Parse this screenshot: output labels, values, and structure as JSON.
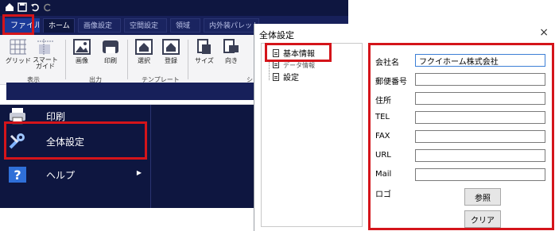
{
  "ribbon": {
    "tabs": [
      {
        "label": "ファイル"
      },
      {
        "label": "ホーム"
      },
      {
        "label": "画像設定"
      },
      {
        "label": "空間設定"
      },
      {
        "label": "領域"
      },
      {
        "label": "内外装パレット"
      }
    ],
    "buttons": [
      {
        "label": "グリッド",
        "icon": "grid-icon"
      },
      {
        "label": "スマート\nガイド",
        "icon": "smart-guide-icon"
      },
      {
        "label": "画像",
        "icon": "image-icon"
      },
      {
        "label": "印刷",
        "icon": "print-icon"
      },
      {
        "label": "選択",
        "icon": "house-select-icon"
      },
      {
        "label": "登録",
        "icon": "house-register-icon"
      },
      {
        "label": "サイズ",
        "icon": "size-icon"
      },
      {
        "label": "向き",
        "icon": "orientation-icon"
      }
    ],
    "groups": [
      {
        "label": "表示"
      },
      {
        "label": "出力"
      },
      {
        "label": "テンプレート"
      },
      {
        "label": "シ"
      }
    ]
  },
  "file_menu": {
    "items": [
      {
        "label": "印刷",
        "icon": "printer-icon"
      },
      {
        "label": "全体設定",
        "icon": "tools-settings-icon"
      },
      {
        "label": "ヘルプ",
        "icon": "help-icon",
        "has_submenu": true
      }
    ]
  },
  "dialog": {
    "title": "全体設定",
    "close_glyph": "×",
    "tree": [
      {
        "label": "基本情報",
        "selected": true
      },
      {
        "label": "データ情報"
      },
      {
        "label": "設定"
      }
    ],
    "form": {
      "fields": [
        {
          "label": "会社名",
          "value": "フクイホーム株式会社"
        },
        {
          "label": "郵便番号",
          "value": ""
        },
        {
          "label": "住所",
          "value": ""
        },
        {
          "label": "TEL",
          "value": ""
        },
        {
          "label": "FAX",
          "value": ""
        },
        {
          "label": "URL",
          "value": ""
        },
        {
          "label": "Mail",
          "value": ""
        }
      ],
      "logo_label": "ロゴ",
      "browse_button": "参照",
      "clear_button": "クリア"
    }
  },
  "colors": {
    "app_background": "#0e1640",
    "file_tab": "#1b3a99",
    "highlight": "#d4141a"
  }
}
